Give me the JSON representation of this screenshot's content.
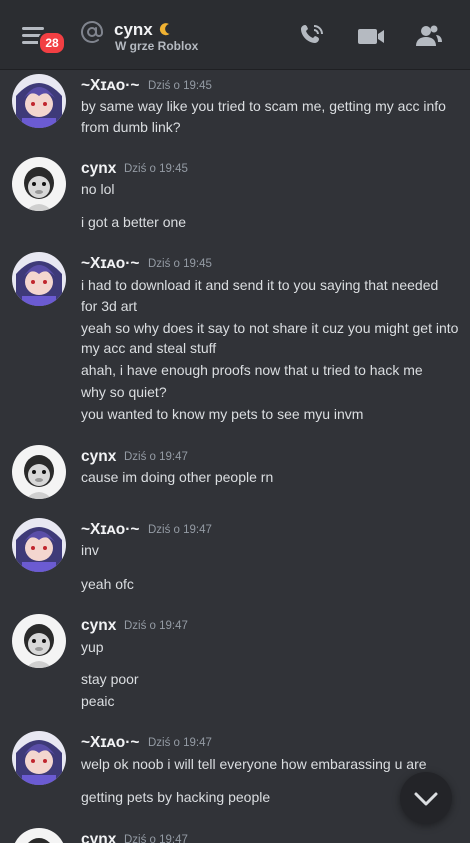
{
  "header": {
    "badge": "28",
    "name": "cynx",
    "status": "W grze Roblox"
  },
  "messages": [
    {
      "author": "~Xɪᴀᴏ·~",
      "time": "Dziś o 19:45",
      "avatar": "anime",
      "lines": [
        "by same way like you tried to scam me, getting my acc info",
        "from dumb link?"
      ]
    },
    {
      "author": "cynx",
      "time": "Dziś o 19:45",
      "avatar": "monkey",
      "lines": [
        "no lol",
        "i got a better one"
      ]
    },
    {
      "author": "~Xɪᴀᴏ·~",
      "time": "Dziś o 19:45",
      "avatar": "anime",
      "lines": [
        "i had to download it and send it to you saying that needed",
        "for 3d art",
        "yeah so why does it say to not share it cuz you might get into",
        "my acc and steal stuff",
        "ahah, i have enough proofs now that u tried to hack me",
        "why so quiet?",
        "you wanted to know my pets to see myu invm"
      ]
    },
    {
      "author": "cynx",
      "time": "Dziś o 19:47",
      "avatar": "monkey",
      "lines": [
        "cause im doing other people rn"
      ]
    },
    {
      "author": "~Xɪᴀᴏ·~",
      "time": "Dziś o 19:47",
      "avatar": "anime",
      "lines": [
        "inv",
        "yeah ofc"
      ]
    },
    {
      "author": "cynx",
      "time": "Dziś o 19:47",
      "avatar": "monkey",
      "lines": [
        "yup",
        "stay poor",
        "peaic"
      ]
    },
    {
      "author": "~Xɪᴀᴏ·~",
      "time": "Dziś o 19:47",
      "avatar": "anime",
      "lines": [
        "welp ok noob i will tell everyone how embarassing u are",
        "getting pets by hacking people"
      ]
    },
    {
      "author": "cynx",
      "time": "Dziś o 19:47",
      "avatar": "monkey",
      "lines": []
    }
  ],
  "icons": {
    "menu": "hamburger-menu-icon",
    "dm": "at-sign-icon",
    "status": "moon-icon",
    "call": "phone-call-icon",
    "video": "video-camera-icon",
    "members": "member-list-icon",
    "scroll": "chevron-down-icon"
  },
  "colors": {
    "background": "#313338",
    "header": "#2b2d31",
    "badge": "#f23f43",
    "moon": "#f0b232",
    "timestamp": "#949ba4"
  }
}
